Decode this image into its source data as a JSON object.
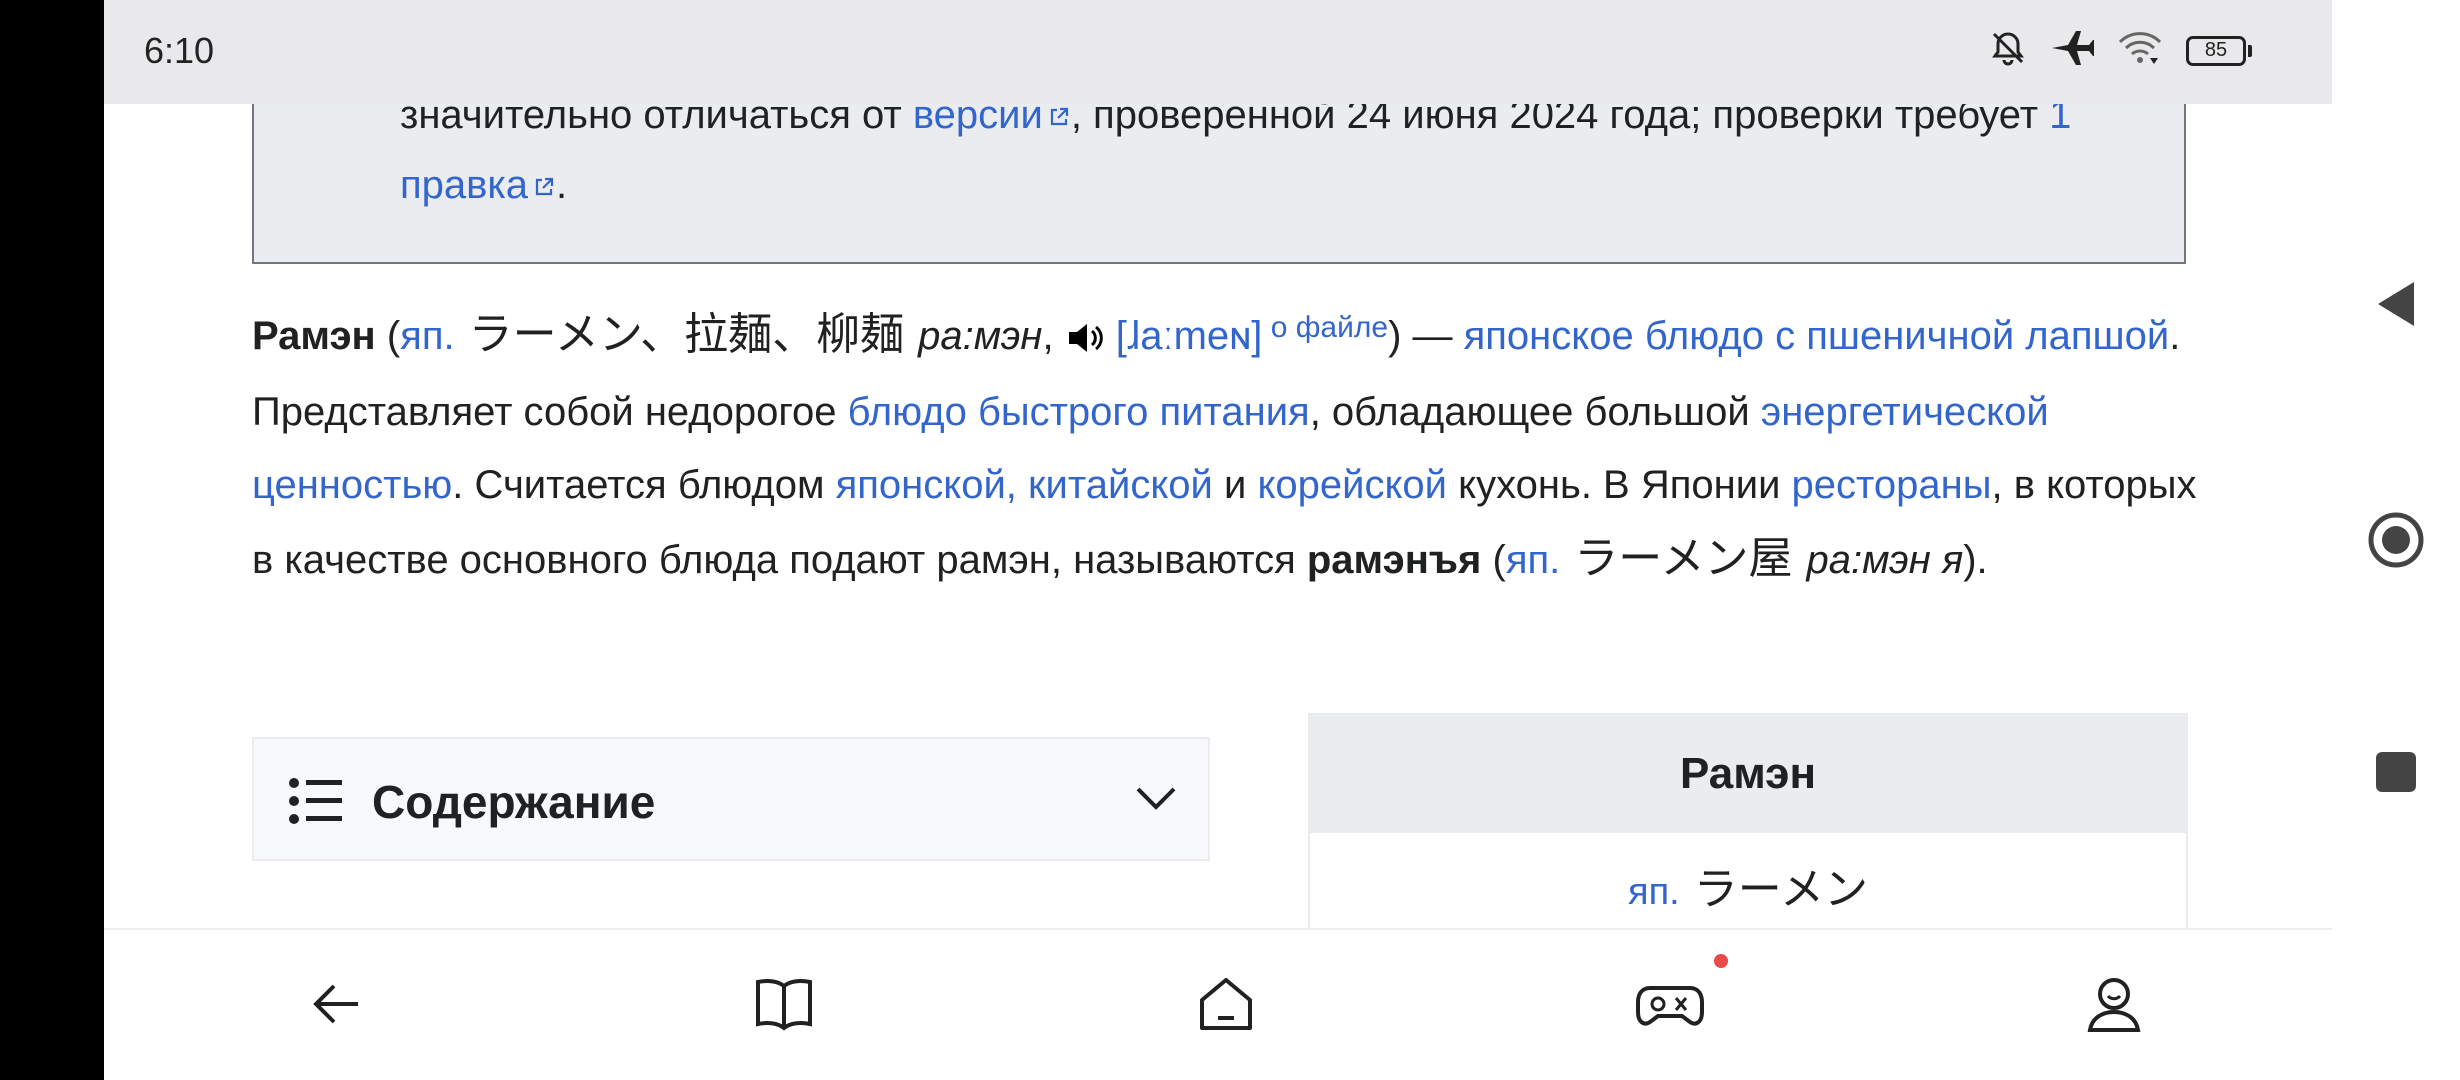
{
  "status_bar": {
    "time": "6:10",
    "battery": "85"
  },
  "notice": {
    "t1": "значительно отличаться от ",
    "l1": "версии",
    "t2": ", проверенной 24 июня 2024 года; проверки требует ",
    "l2": "1 правка",
    "t3": "."
  },
  "lead": {
    "b1": "Рамэн",
    "p1": " (",
    "l_jp": "яп.",
    "jp1": " ラーメン、拉麺、柳麺 ",
    "i1": "ра:мэн",
    "p2": ", ",
    "ipa": "[ɺaːmeɴ]",
    "sup": " о файле",
    "p3": ") — ",
    "l_dish": "японское блюдо с пшеничной лапшой",
    "p4": ". Представляет собой недорогое ",
    "l_fast": "блюдо быстрого питания",
    "p5": ", обладающее большой ",
    "l_energy": "энергетической ценностью",
    "p6": ". Считается блюдом ",
    "l_jc": "японской, китайской",
    "p7": " и ",
    "l_kor": "корейской",
    "p8": " кухонь. В Японии ",
    "l_rest": "рестораны",
    "p9": ", в которых в качестве основного блюда подают рамэн, называются ",
    "b2": "рамэнъя",
    "p10": " (",
    "l_jp2": "яп.",
    "jp2": " ラーメン屋 ",
    "i2": "ра:мэн я",
    "p11": ")."
  },
  "toc": {
    "title": "Содержание"
  },
  "infobox": {
    "title": "Рамэн",
    "lang": "яп.",
    "name": " ラーメン"
  },
  "bottom_nav": {
    "items": [
      "back-arrow-icon",
      "book-icon",
      "home-icon",
      "gamepad-icon",
      "profile-icon"
    ],
    "badge_color": "#e94a4a"
  },
  "colors": {
    "link": "#3366cc",
    "text": "#202122",
    "notice_bg": "#eaecf0"
  }
}
